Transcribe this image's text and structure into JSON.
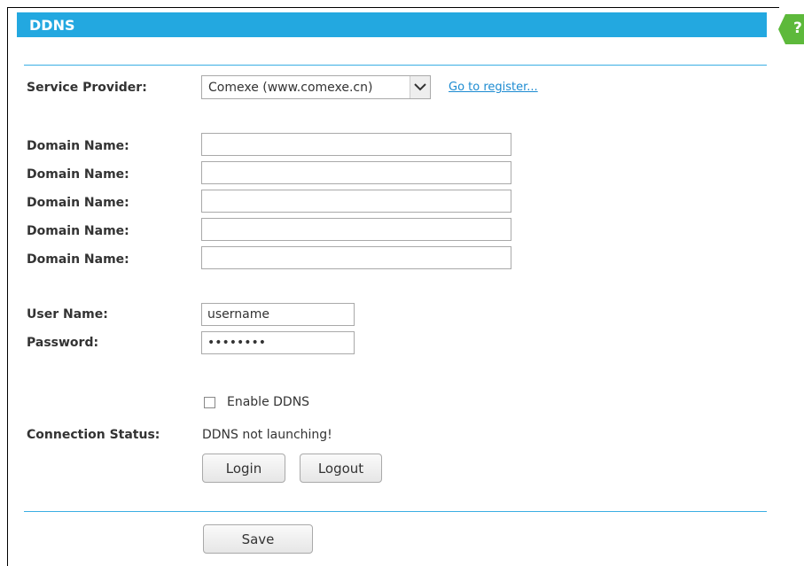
{
  "header": {
    "title": "DDNS"
  },
  "help": {
    "label": "?",
    "color": "#5db93b"
  },
  "form": {
    "service_provider": {
      "label": "Service Provider:",
      "selected": "Comexe (www.comexe.cn)",
      "register_link": "Go to register..."
    },
    "domains": [
      {
        "label": "Domain Name:",
        "value": ""
      },
      {
        "label": "Domain Name:",
        "value": ""
      },
      {
        "label": "Domain Name:",
        "value": ""
      },
      {
        "label": "Domain Name:",
        "value": ""
      },
      {
        "label": "Domain Name:",
        "value": ""
      }
    ],
    "username": {
      "label": "User Name:",
      "value": "username"
    },
    "password": {
      "label": "Password:",
      "value": "••••••••"
    },
    "enable_ddns": {
      "label": "Enable DDNS",
      "checked": false
    },
    "connection_status": {
      "label": "Connection Status:",
      "value": "DDNS not launching!"
    },
    "buttons": {
      "login": "Login",
      "logout": "Logout",
      "save": "Save"
    }
  },
  "colors": {
    "accent": "#23a8e0",
    "divider": "#3aaee3",
    "link": "#1c8bd1"
  }
}
